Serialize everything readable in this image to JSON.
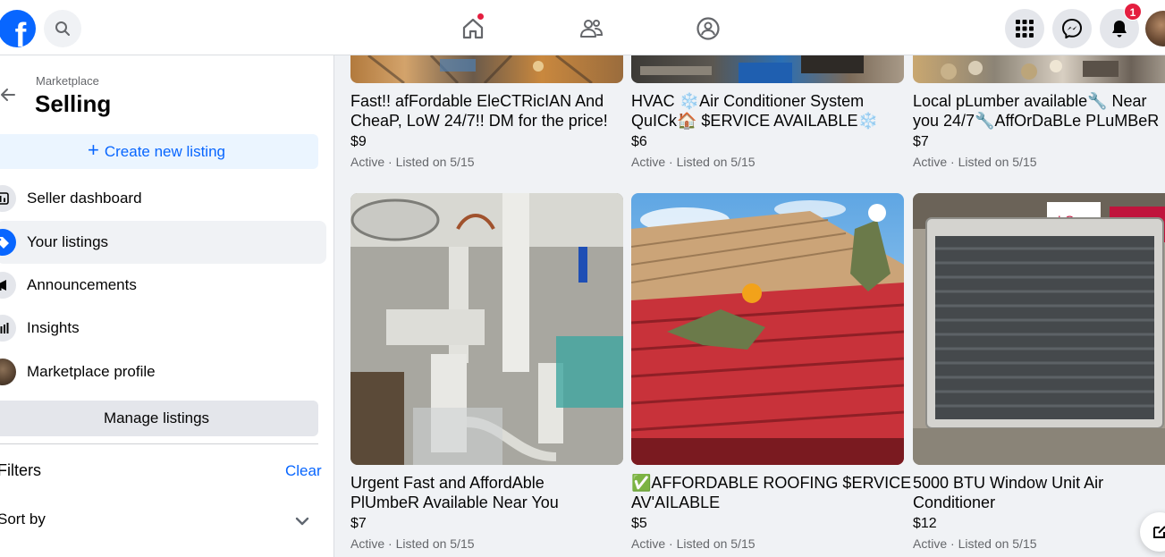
{
  "topbar": {
    "logo_letter": "f",
    "notification_count": "1",
    "icons": [
      "facebook-logo",
      "search-icon",
      "home-icon",
      "friends-icon",
      "groups-icon",
      "menu-grid-icon",
      "messenger-icon",
      "notifications-bell-icon",
      "profile-avatar"
    ]
  },
  "sidebar": {
    "breadcrumb": "Marketplace",
    "title": "Selling",
    "create_label": "Create new listing",
    "items": [
      {
        "label": "Seller dashboard",
        "icon": "dashboard-icon"
      },
      {
        "label": "Your listings",
        "icon": "tag-icon",
        "active": true
      },
      {
        "label": "Announcements",
        "icon": "megaphone-icon"
      },
      {
        "label": "Insights",
        "icon": "bar-chart-icon"
      },
      {
        "label": "Marketplace profile",
        "icon": "profile-photo"
      }
    ],
    "manage_label": "Manage listings",
    "filters_label": "Filters",
    "clear_label": "Clear",
    "sort_label": "Sort by"
  },
  "listings": [
    {
      "title_line1": "Fast!! afFordable EleCTRicIAN And",
      "title_line2": "CheaP, LoW 24/7!! DM for the price!",
      "price": "$9",
      "status": "Active · Listed on 5/15"
    },
    {
      "title_line1": "HVAC ❄️Air Conditioner System",
      "title_line2": "QuICk🏠 $ERVICE AVAILABLE❄️",
      "price": "$6",
      "status": "Active · Listed on 5/15"
    },
    {
      "title_line1": "Local pLumber available🔧 Near",
      "title_line2": "you 24/7🔧AffOrDaBLe PLuMBeR",
      "price": "$7",
      "status": "Active · Listed on 5/15"
    },
    {
      "title_line1": "Urgent Fast and AffordAble",
      "title_line2": "PlUmbeR Available Near You",
      "price": "$7",
      "status": "Active · Listed on 5/15"
    },
    {
      "title_line1": "✅AFFORDABLE ROOFING $ERVICE",
      "title_line2": "AV'AILABLE",
      "price": "$5",
      "status": "Active · Listed on 5/15"
    },
    {
      "title_line1": "5000 BTU Window Unit Air",
      "title_line2": "Conditioner",
      "price": "$12",
      "status": "Active · Listed on 5/15"
    }
  ],
  "product_labels": {
    "ac_brand": "LG"
  },
  "colors": {
    "brand_blue": "#0866ff",
    "badge_red": "#e41e3f",
    "roof_red": "#c8323a"
  }
}
